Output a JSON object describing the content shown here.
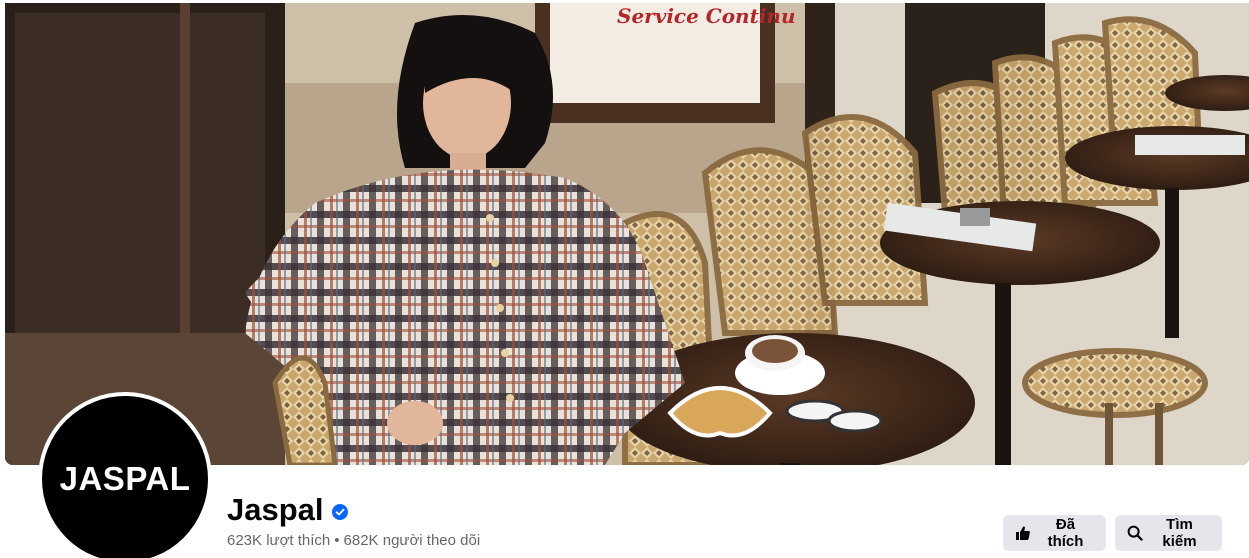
{
  "cover": {
    "sign_text": "Service Continu"
  },
  "profile": {
    "avatar_text": "JASPAL",
    "name": "Jaspal",
    "verified_icon": "verified-badge-icon",
    "likes": "623K lượt thích",
    "separator": "•",
    "followers": "682K người theo dõi"
  },
  "actions": {
    "liked": {
      "label": "Đã thích",
      "icon": "thumbs-up-icon"
    },
    "search": {
      "label": "Tìm kiếm",
      "icon": "search-icon"
    }
  },
  "colors": {
    "verified": "#0866ff",
    "button_bg": "#e4e6eb",
    "secondary_text": "#65676b"
  }
}
